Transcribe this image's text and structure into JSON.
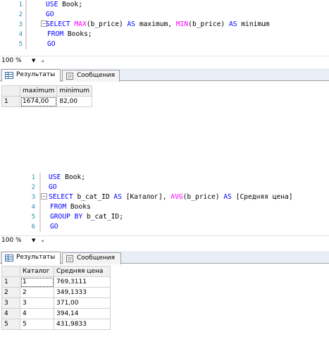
{
  "query1": {
    "lines": [
      {
        "n": "1",
        "segments": [
          {
            "t": "USE ",
            "c": "kw"
          },
          {
            "t": "Book;",
            "c": ""
          }
        ]
      },
      {
        "n": "2",
        "segments": [
          {
            "t": "GO",
            "c": "kw"
          }
        ]
      },
      {
        "n": "3",
        "segments": [
          {
            "t": "SELECT ",
            "c": "kw"
          },
          {
            "t": "MAX",
            "c": "fn"
          },
          {
            "t": "(b_price) ",
            "c": ""
          },
          {
            "t": "AS ",
            "c": "kw"
          },
          {
            "t": "maximum, ",
            "c": ""
          },
          {
            "t": "MIN",
            "c": "fn"
          },
          {
            "t": "(b_price) ",
            "c": ""
          },
          {
            "t": "AS ",
            "c": "kw"
          },
          {
            "t": "minimum",
            "c": ""
          }
        ]
      },
      {
        "n": "4",
        "segments": [
          {
            "t": "FROM ",
            "c": "kw"
          },
          {
            "t": "Books;",
            "c": ""
          }
        ]
      },
      {
        "n": "5",
        "segments": [
          {
            "t": "GO",
            "c": "kw"
          }
        ]
      }
    ],
    "zoom": "100 %",
    "tabs": {
      "results": "Результаты",
      "messages": "Сообщения"
    },
    "columns": [
      "maximum",
      "minimum"
    ],
    "rows": [
      {
        "rn": "1",
        "cells": [
          "1674,00",
          "82,00"
        ]
      }
    ]
  },
  "query2": {
    "lines": [
      {
        "n": "1",
        "segments": [
          {
            "t": "USE ",
            "c": "kw"
          },
          {
            "t": "Book;",
            "c": ""
          }
        ]
      },
      {
        "n": "2",
        "segments": [
          {
            "t": "GO",
            "c": "kw"
          }
        ]
      },
      {
        "n": "3",
        "segments": [
          {
            "t": "SELECT ",
            "c": "kw"
          },
          {
            "t": "b_cat_ID ",
            "c": ""
          },
          {
            "t": "AS ",
            "c": "kw"
          },
          {
            "t": "[Каталог], ",
            "c": ""
          },
          {
            "t": "AVG",
            "c": "fn"
          },
          {
            "t": "(b_price) ",
            "c": ""
          },
          {
            "t": "AS ",
            "c": "kw"
          },
          {
            "t": "[Средняя цена]",
            "c": ""
          }
        ]
      },
      {
        "n": "4",
        "segments": [
          {
            "t": "FROM ",
            "c": "kw"
          },
          {
            "t": "Books",
            "c": ""
          }
        ]
      },
      {
        "n": "5",
        "segments": [
          {
            "t": "GROUP BY ",
            "c": "kw"
          },
          {
            "t": "b_cat_ID;",
            "c": ""
          }
        ]
      },
      {
        "n": "6",
        "segments": [
          {
            "t": "GO",
            "c": "kw"
          }
        ]
      }
    ],
    "zoom": "100 %",
    "tabs": {
      "results": "Результаты",
      "messages": "Сообщения"
    },
    "columns": [
      "Каталог",
      "Средняя цена"
    ],
    "rows": [
      {
        "rn": "1",
        "cells": [
          "1",
          "769,3111"
        ]
      },
      {
        "rn": "2",
        "cells": [
          "2",
          "349,1333"
        ]
      },
      {
        "rn": "3",
        "cells": [
          "3",
          "371,00"
        ]
      },
      {
        "rn": "4",
        "cells": [
          "4",
          "394,14"
        ]
      },
      {
        "rn": "5",
        "cells": [
          "5",
          "431,9833"
        ]
      }
    ]
  },
  "icons": {
    "grid": "grid-icon",
    "messages": "messages-icon",
    "dropdown": "dropdown-arrow-icon",
    "fold": "collapse-minus-icon"
  },
  "colors": {
    "keyword": "#0000ff",
    "function": "#ff00ff",
    "line_number": "#2b91af"
  }
}
